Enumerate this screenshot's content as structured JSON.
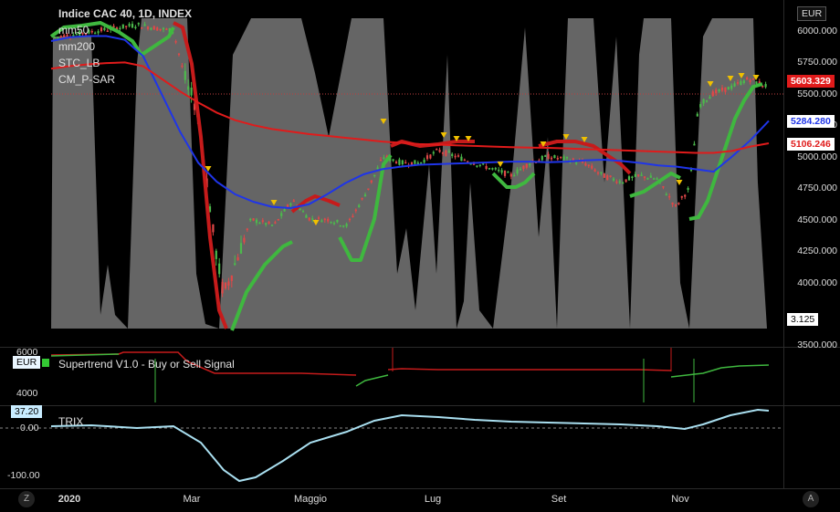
{
  "header": {
    "symbol_title": "Indice CAC 40, 1D, INDEX",
    "currency_button": "EUR"
  },
  "legend": {
    "items": [
      "mm50",
      "mm200",
      "STC_LB",
      "CM_P-SAR"
    ]
  },
  "price_axis": {
    "ticks": [
      "6000.000",
      "5750.000",
      "5500.000",
      "5250.000",
      "5000.000",
      "4750.000",
      "4500.000",
      "4250.000",
      "4000.000",
      "3750.000",
      "3500.000"
    ]
  },
  "price_labels": {
    "last_price": "5603.329",
    "mm50_value": "5284.280",
    "mm200_value": "5106.246",
    "stc_value": "3.125"
  },
  "supertrend_pane": {
    "title": "Supertrend V1.0 - Buy or Sell Signal",
    "currency_badge": "EUR",
    "ticks": [
      "6000",
      "4000"
    ]
  },
  "trix_pane": {
    "title": "TRIX",
    "value_badge": "37.20",
    "ticks": [
      "0.00",
      "-100.00"
    ]
  },
  "time_axis": {
    "labels": [
      "2020",
      "Mar",
      "Maggio",
      "Lug",
      "Set",
      "Nov"
    ]
  },
  "bottom_buttons": {
    "left": "Z",
    "right": "A"
  },
  "colors": {
    "background": "#000000",
    "stc_fill": "#707070",
    "mm50": "#1f35e8",
    "mm200": "#e01b1b",
    "psar_bull": "#3fb83f",
    "psar_bear": "#c61b1b",
    "candle_up": "#4cba4c",
    "candle_down": "#e04848",
    "trix": "#a9dff0",
    "signal_marker": "#f0c000"
  },
  "chart_data": {
    "type": "line",
    "y_scale_main": [
      3500,
      6000
    ],
    "series": [
      {
        "name": "mm50",
        "values": [
          5920,
          5950,
          5960,
          5960,
          5930,
          5800,
          5500,
          5200,
          4950,
          4800,
          4700,
          4640,
          4600,
          4590,
          4620,
          4700,
          4790,
          4860,
          4900,
          4920,
          4935,
          4940,
          4945,
          4950,
          4955,
          4960,
          4960,
          4955,
          4960,
          4970,
          4975,
          4965,
          4950,
          4930,
          4920,
          4900,
          4880,
          5000,
          5130,
          5284.28
        ]
      },
      {
        "name": "mm200",
        "values": [
          5700,
          5720,
          5735,
          5745,
          5750,
          5720,
          5620,
          5520,
          5430,
          5350,
          5290,
          5250,
          5220,
          5200,
          5180,
          5165,
          5150,
          5135,
          5120,
          5110,
          5100,
          5095,
          5090,
          5085,
          5080,
          5075,
          5072,
          5070,
          5065,
          5060,
          5055,
          5050,
          5045,
          5040,
          5035,
          5030,
          5030,
          5045,
          5080,
          5106.246
        ]
      }
    ]
  }
}
